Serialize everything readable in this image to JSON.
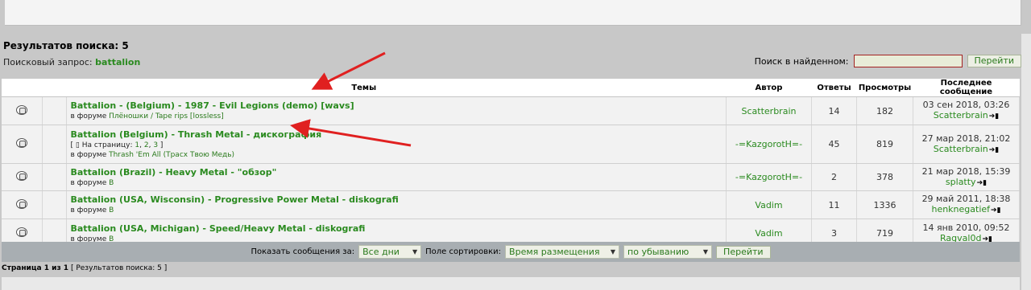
{
  "results": {
    "title": "Результатов поиска: 5",
    "query_label": "Поисковый запрос:",
    "query_value": "battalion"
  },
  "within_search": {
    "label": "Поиск в найденном:",
    "value": "",
    "button": "Перейти"
  },
  "table": {
    "headers": {
      "topics": "Темы",
      "author": "Автор",
      "replies": "Ответы",
      "views": "Просмотры",
      "last": "Последнее сообщение"
    },
    "in_forum_label": "в форуме",
    "rows": [
      {
        "title": "Battalion - (Belgium) - 1987 - Evil Legions (demo) [wavs]",
        "forum": "Плёношки / Tape rips [lossless]",
        "author": "Scatterbrain",
        "replies": "14",
        "views": "182",
        "last_date": "03 сен 2018, 03:26",
        "last_user": "Scatterbrain"
      },
      {
        "title": "Battalion (Belgium) - Thrash Metal - дискография",
        "pages_open": "[",
        "pages_label": "На страницу:",
        "pages": [
          "1",
          "2",
          "3"
        ],
        "pages_close": "]",
        "forum": "Thrash 'Em All (Трасх Твою Медь)",
        "author": "-=KazgorotH=-",
        "replies": "45",
        "views": "819",
        "last_date": "27 мар 2018, 21:02",
        "last_user": "Scatterbrain"
      },
      {
        "title": "Battalion (Brazil) - Heavy Metal - \"обзор\"",
        "forum": "B",
        "author": "-=KazgorotH=-",
        "replies": "2",
        "views": "378",
        "last_date": "21 мар 2018, 15:39",
        "last_user": "splatty"
      },
      {
        "title": "Battalion (USA, Wisconsin) - Progressive Power Metal - diskografi",
        "forum": "B",
        "author": "Vadim",
        "replies": "11",
        "views": "1336",
        "last_date": "29 май 2011, 18:38",
        "last_user": "henknegatief"
      },
      {
        "title": "Battalion (USA, Michigan) - Speed/Heavy Metal - diskografi",
        "forum": "B",
        "author": "Vadim",
        "replies": "3",
        "views": "719",
        "last_date": "14 янв 2010, 09:52",
        "last_user": "Ragval0d"
      }
    ]
  },
  "bottom_bar": {
    "show_label": "Показать сообщения за:",
    "show_value": "Все дни",
    "sort_label": "Поле сортировки:",
    "sort_value": "Время размещения",
    "order_value": "по убыванию",
    "button": "Перейти"
  },
  "footer": {
    "page_text": "Страница 1 из 1",
    "results_text": "[ Результатов поиска: 5 ]"
  },
  "colors": {
    "link_green": "#2a8a1f",
    "annotation_red": "#e02020",
    "bar_gray": "#a8aeb2"
  },
  "icons": {
    "topic": "topic-read-icon",
    "goto_last": "goto-last-post-icon",
    "page": "page-icon"
  }
}
